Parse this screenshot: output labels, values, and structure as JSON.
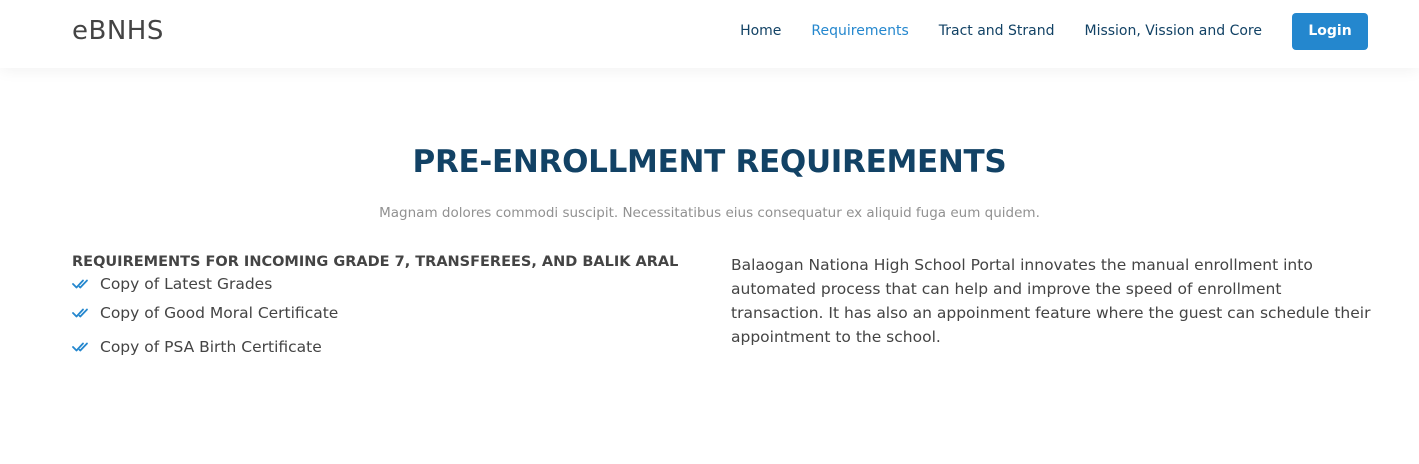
{
  "header": {
    "logo": "eBNHS",
    "nav": [
      {
        "label": "Home"
      },
      {
        "label": "Requirements"
      },
      {
        "label": "Tract and Strand"
      },
      {
        "label": "Mission, Vission and Core"
      }
    ],
    "login_label": "Login"
  },
  "section": {
    "title": "PRE-ENROLLMENT REQUIREMENTS",
    "subtitle": "Magnam dolores commodi suscipit. Necessitatibus eius consequatur ex aliquid fuga eum quidem."
  },
  "requirements": {
    "heading": "REQUIREMENTS FOR INCOMING GRADE 7, TRANSFEREES, AND BALIK ARAL",
    "items": [
      {
        "label": "Copy of Latest Grades",
        "icon": "double-check-icon"
      },
      {
        "label": "Copy of Good Moral Certificate",
        "icon": "double-check-icon"
      },
      {
        "label": "Copy of PSA Birth Certificate",
        "icon": "double-check-icon"
      }
    ]
  },
  "description": "Balaogan Nationa High School Portal innovates the manual enrollment into automated process that can help and improve the speed of enrollment transaction. It has also an appoinment feature where the guest can schedule their appointment to the school.",
  "colors": {
    "accent": "#2487ce",
    "heading": "#124265",
    "text": "#444444",
    "muted": "#919191"
  }
}
